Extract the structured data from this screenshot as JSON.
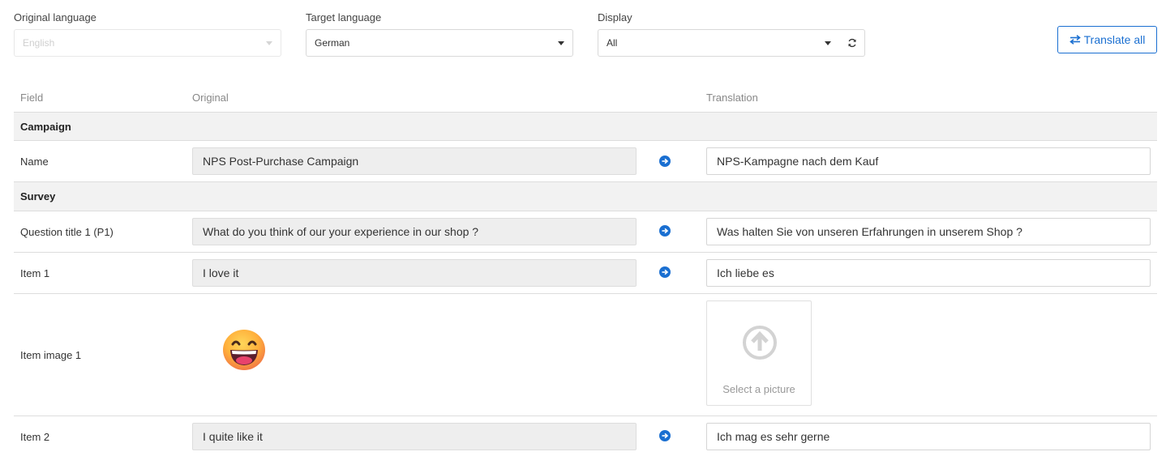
{
  "filters": {
    "original_language": {
      "label": "Original language",
      "value": "English"
    },
    "target_language": {
      "label": "Target language",
      "value": "German"
    },
    "display": {
      "label": "Display",
      "value": "All"
    },
    "translate_all_label": "Translate all"
  },
  "table": {
    "headers": {
      "field": "Field",
      "original": "Original",
      "translation": "Translation"
    },
    "sections": {
      "campaign": "Campaign",
      "survey": "Survey"
    },
    "rows": [
      {
        "field": "Name",
        "original": "NPS Post-Purchase Campaign",
        "translation": "NPS-Kampagne nach dem Kauf"
      },
      {
        "field": "Question title 1 (P1)",
        "original": "What do you think of our your experience in our shop ?",
        "translation": "Was halten Sie von unseren Erfahrungen in unserem Shop ?"
      },
      {
        "field": "Item 1",
        "original": "I love it",
        "translation": "Ich liebe es"
      },
      {
        "field": "Item image 1",
        "picker_label": "Select a picture"
      },
      {
        "field": "Item 2",
        "original": "I quite like it",
        "translation": "Ich mag es sehr gerne"
      }
    ]
  },
  "icons": {
    "refresh": "refresh-icon",
    "swap": "swap-arrows-icon",
    "copy_arrow": "arrow-right-circle-icon",
    "upload": "upload-arrow-icon",
    "emoji": "grinning-face-emoji"
  },
  "colors": {
    "accent": "#1a6fd1",
    "section_bg": "#f2f2f2",
    "original_bg": "#eeeeee"
  }
}
